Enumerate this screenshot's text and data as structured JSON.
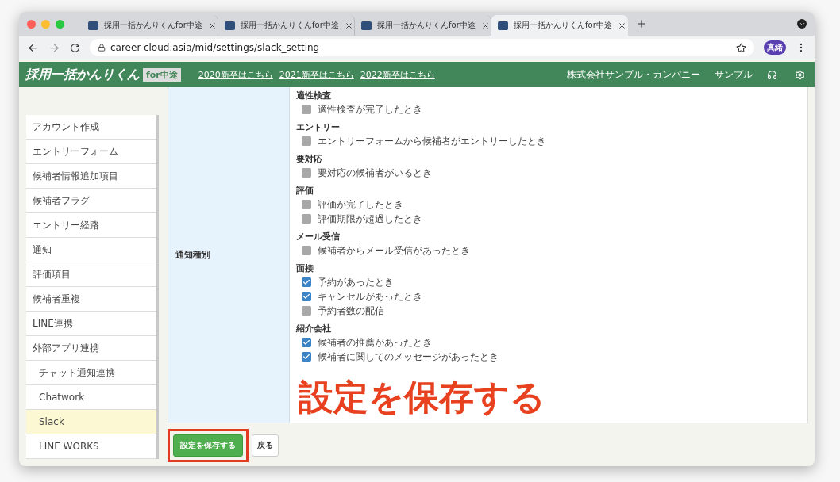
{
  "browser": {
    "tabs": [
      {
        "title": "採用一括かんりくんfor中途",
        "selected": false
      },
      {
        "title": "採用一括かんりくんfor中途",
        "selected": false
      },
      {
        "title": "採用一括かんりくんfor中途",
        "selected": false
      },
      {
        "title": "採用一括かんりくんfor中途",
        "selected": true
      }
    ],
    "url": "career-cloud.asia/mid/settings/slack_setting",
    "avatar": "真緒"
  },
  "header": {
    "logo": "採用一括かんりくん",
    "logo_badge": "for中途",
    "links": [
      "2020新卒はこちら",
      "2021新卒はこちら",
      "2022新卒はこちら"
    ],
    "company": "株式会社サンプル・カンパニー",
    "user": "サンプル"
  },
  "sidebar": {
    "items": [
      {
        "label": "アカウント作成",
        "selected": false
      },
      {
        "label": "エントリーフォーム",
        "selected": false
      },
      {
        "label": "候補者情報追加項目",
        "selected": false
      },
      {
        "label": "候補者フラグ",
        "selected": false
      },
      {
        "label": "エントリー経路",
        "selected": false
      },
      {
        "label": "通知",
        "selected": false
      },
      {
        "label": "評価項目",
        "selected": false
      },
      {
        "label": "候補者重複",
        "selected": false
      },
      {
        "label": "LINE連携",
        "selected": false
      },
      {
        "label": "外部アプリ連携",
        "selected": false,
        "children": [
          {
            "label": "チャット通知連携",
            "selected": false
          },
          {
            "label": "Chatwork",
            "selected": false
          },
          {
            "label": "Slack",
            "selected": true
          },
          {
            "label": "LINE WORKS",
            "selected": false
          }
        ]
      }
    ]
  },
  "form": {
    "label": "通知種別",
    "groups": [
      {
        "title": "適性検査",
        "options": [
          {
            "label": "適性検査が完了したとき",
            "checked": false
          }
        ]
      },
      {
        "title": "エントリー",
        "options": [
          {
            "label": "エントリーフォームから候補者がエントリーしたとき",
            "checked": false
          }
        ]
      },
      {
        "title": "要対応",
        "options": [
          {
            "label": "要対応の候補者がいるとき",
            "checked": false
          }
        ]
      },
      {
        "title": "評価",
        "options": [
          {
            "label": "評価が完了したとき",
            "checked": false
          },
          {
            "label": "評価期限が超過したとき",
            "checked": false
          }
        ]
      },
      {
        "title": "メール受信",
        "options": [
          {
            "label": "候補者からメール受信があったとき",
            "checked": false
          }
        ]
      },
      {
        "title": "面接",
        "options": [
          {
            "label": "予約があったとき",
            "checked": true
          },
          {
            "label": "キャンセルがあったとき",
            "checked": true
          },
          {
            "label": "予約者数の配信",
            "checked": false
          }
        ]
      },
      {
        "title": "紹介会社",
        "options": [
          {
            "label": "候補者の推薦があったとき",
            "checked": true
          },
          {
            "label": "候補者に関してのメッセージがあったとき",
            "checked": true
          }
        ]
      }
    ]
  },
  "buttons": {
    "save": "設定を保存する",
    "back": "戻る"
  },
  "callout": "設定を保存する"
}
